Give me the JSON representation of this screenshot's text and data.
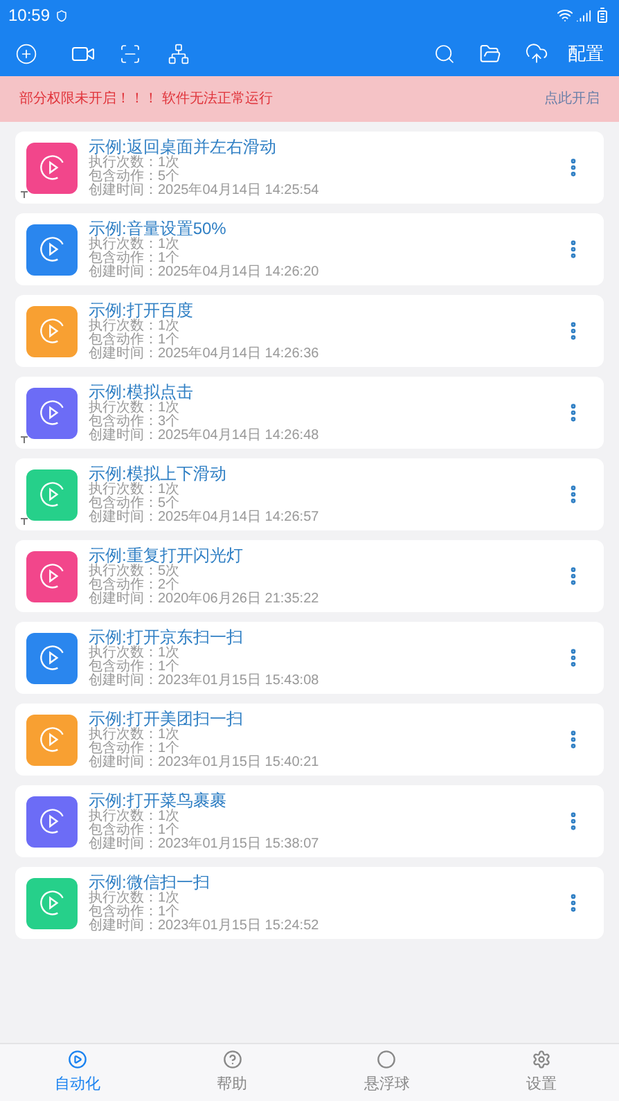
{
  "status_bar": {
    "time": "10:59"
  },
  "toolbar": {
    "config_label": "配置"
  },
  "banner": {
    "message": "部分权限未开启！！！ 软件无法正常运行",
    "action": "点此开启"
  },
  "scripts": [
    {
      "title": "示例:返回桌面并左右滑动",
      "runs": "执行次数：1次",
      "actions": "包含动作：5个",
      "created": "创建时间：2025年04月14日 14:25:54",
      "color": "#f2468b",
      "pinned": true
    },
    {
      "title": "示例:音量设置50%",
      "runs": "执行次数：1次",
      "actions": "包含动作：1个",
      "created": "创建时间：2025年04月14日 14:26:20",
      "color": "#2a86ee",
      "pinned": false
    },
    {
      "title": "示例:打开百度",
      "runs": "执行次数：1次",
      "actions": "包含动作：1个",
      "created": "创建时间：2025年04月14日 14:26:36",
      "color": "#f8a032",
      "pinned": false
    },
    {
      "title": "示例:模拟点击",
      "runs": "执行次数：1次",
      "actions": "包含动作：3个",
      "created": "创建时间：2025年04月14日 14:26:48",
      "color": "#6c6cf6",
      "pinned": true
    },
    {
      "title": "示例:模拟上下滑动",
      "runs": "执行次数：1次",
      "actions": "包含动作：5个",
      "created": "创建时间：2025年04月14日 14:26:57",
      "color": "#26d08a",
      "pinned": true
    },
    {
      "title": "示例:重复打开闪光灯",
      "runs": "执行次数：5次",
      "actions": "包含动作：2个",
      "created": "创建时间：2020年06月26日 21:35:22",
      "color": "#f2468b",
      "pinned": false
    },
    {
      "title": "示例:打开京东扫一扫",
      "runs": "执行次数：1次",
      "actions": "包含动作：1个",
      "created": "创建时间：2023年01月15日 15:43:08",
      "color": "#2a86ee",
      "pinned": false
    },
    {
      "title": "示例:打开美团扫一扫",
      "runs": "执行次数：1次",
      "actions": "包含动作：1个",
      "created": "创建时间：2023年01月15日 15:40:21",
      "color": "#f8a032",
      "pinned": false
    },
    {
      "title": "示例:打开菜鸟裹裹",
      "runs": "执行次数：1次",
      "actions": "包含动作：1个",
      "created": "创建时间：2023年01月15日 15:38:07",
      "color": "#6c6cf6",
      "pinned": false
    },
    {
      "title": "示例:微信扫一扫",
      "runs": "执行次数：1次",
      "actions": "包含动作：1个",
      "created": "创建时间：2023年01月15日 15:24:52",
      "color": "#26d08a",
      "pinned": false
    }
  ],
  "bottom_nav": [
    {
      "label": "自动化",
      "kind": "automation",
      "selected": true
    },
    {
      "label": "帮助",
      "kind": "help",
      "selected": false
    },
    {
      "label": "悬浮球",
      "kind": "float",
      "selected": false
    },
    {
      "label": "设置",
      "kind": "settings",
      "selected": false
    }
  ]
}
